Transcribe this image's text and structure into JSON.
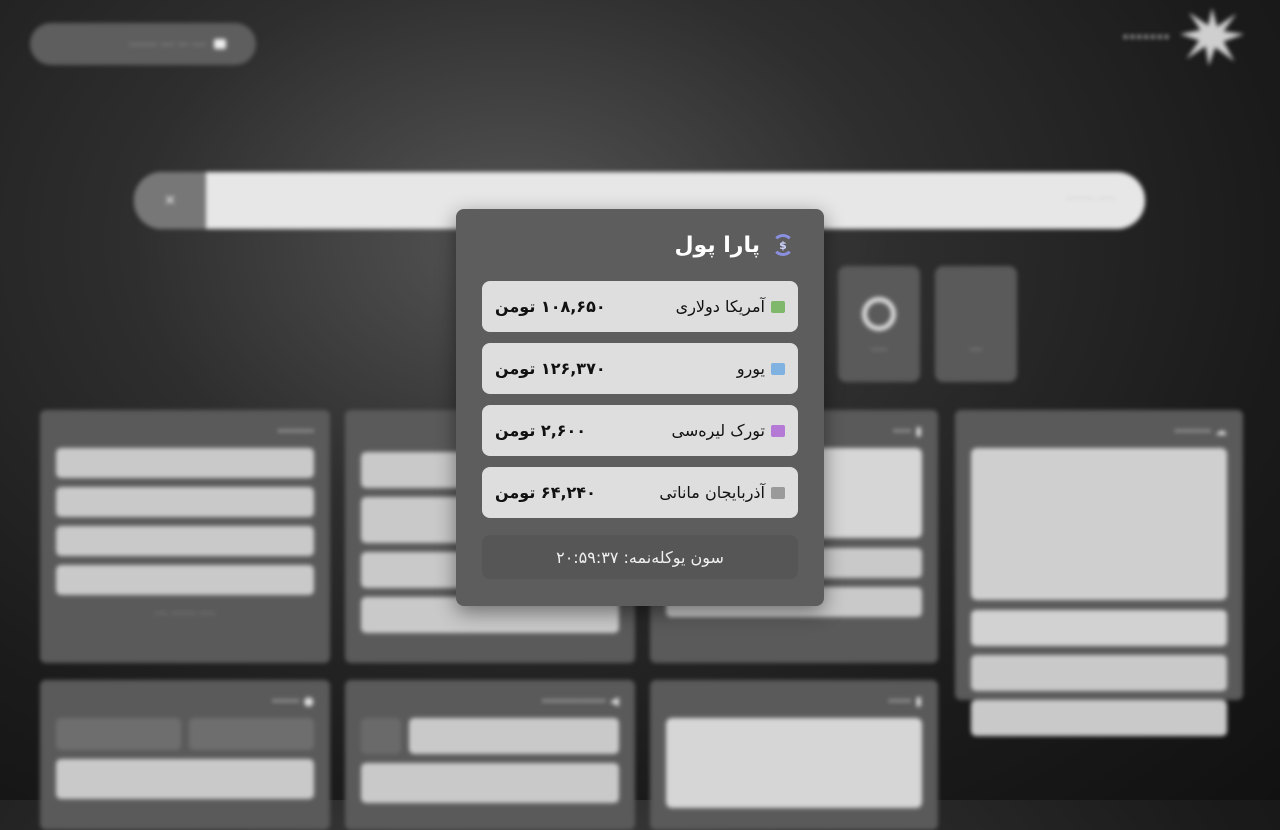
{
  "card": {
    "title": "پارا پول",
    "rates": [
      {
        "name": "آمریکا دولاری",
        "value": "۱۰۸,۶۵۰ تومن",
        "flag_color": "#7fb86a",
        "icon": "money-bill-icon"
      },
      {
        "name": "یورو",
        "value": "۱۲۶,۳۷۰ تومن",
        "flag_color": "#7fb2e0",
        "icon": "euro-bill-icon"
      },
      {
        "name": "تورک لیره‌سی",
        "value": "۲,۶۰۰ تومن",
        "flag_color": "#b57ad6",
        "icon": "lira-bill-icon"
      },
      {
        "name": "آذربایجان ماناتی",
        "value": "۶۴,۲۴۰ تومن",
        "flag_color": "#9a9a9a",
        "icon": "bank-icon"
      }
    ],
    "last_update": "سون یوکله‌نمه: ۲۰:۵۹:۳۷"
  }
}
